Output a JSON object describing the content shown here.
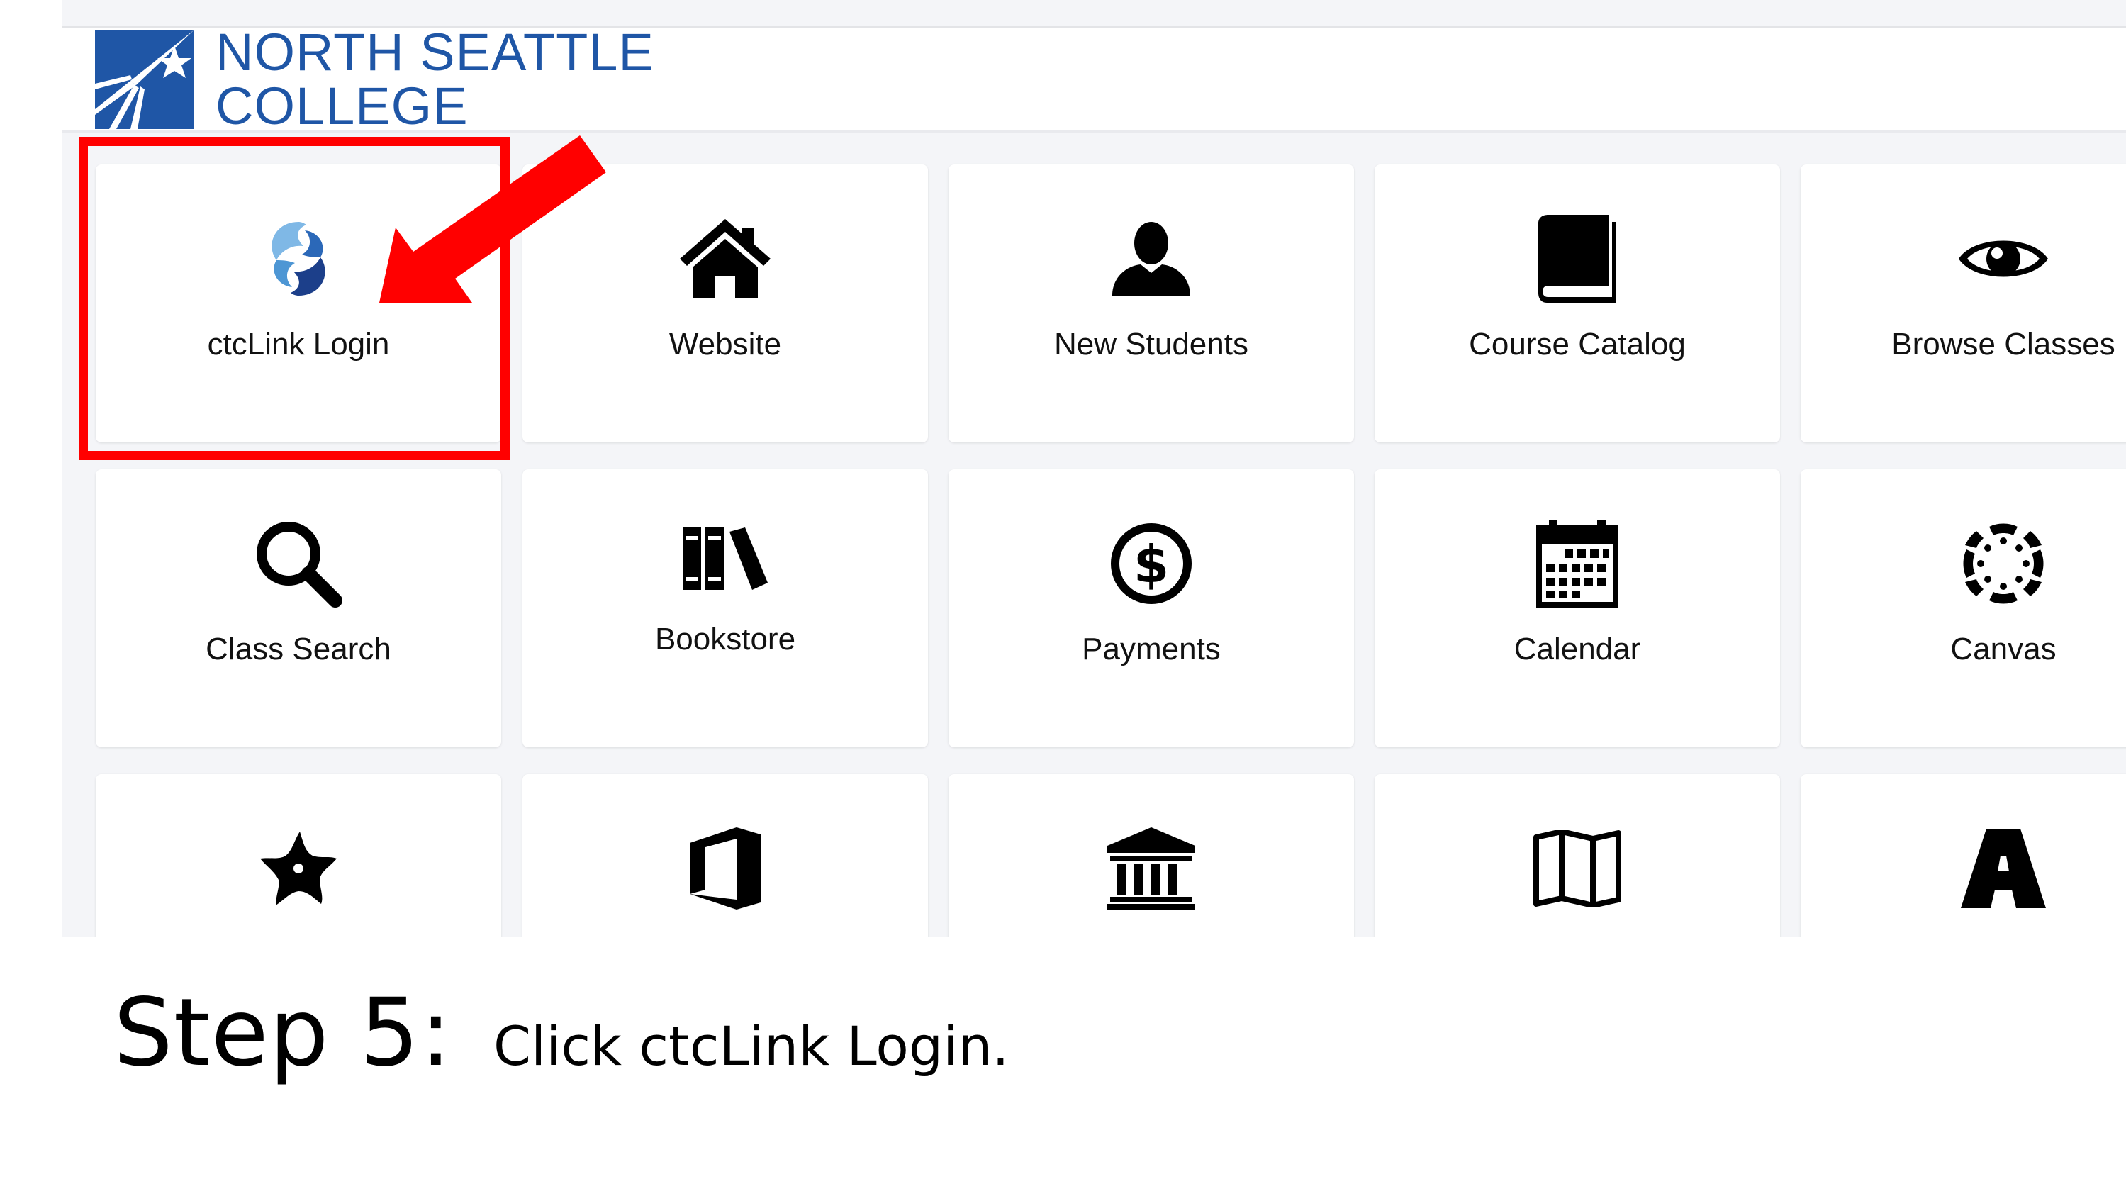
{
  "header": {
    "logo": {
      "line1": "NORTH SEATTLE",
      "line2": "COLLEGE",
      "brand_color": "#1f56a6"
    }
  },
  "tiles": [
    {
      "label": "ctcLink Login",
      "icon": "ctclink-swirl-icon"
    },
    {
      "label": "Website",
      "icon": "home-icon"
    },
    {
      "label": "New Students",
      "icon": "user-icon"
    },
    {
      "label": "Course Catalog",
      "icon": "book-icon"
    },
    {
      "label": "Browse Classes",
      "icon": "eye-icon"
    },
    {
      "label": "Class Search",
      "icon": "search-icon"
    },
    {
      "label": "Bookstore",
      "icon": "books-icon"
    },
    {
      "label": "Payments",
      "icon": "dollar-circle-icon"
    },
    {
      "label": "Calendar",
      "icon": "calendar-icon"
    },
    {
      "label": "Canvas",
      "icon": "canvas-icon"
    },
    {
      "label": "",
      "icon": "starfish-icon"
    },
    {
      "label": "",
      "icon": "office-icon"
    },
    {
      "label": "",
      "icon": "institution-icon"
    },
    {
      "label": "",
      "icon": "map-icon"
    },
    {
      "label": "",
      "icon": "road-icon"
    }
  ],
  "annotation": {
    "highlight_color": "#ff0000",
    "arrow_color": "#ff0000"
  },
  "caption": {
    "step": "Step 5:",
    "text": "Click ctcLink Login."
  }
}
